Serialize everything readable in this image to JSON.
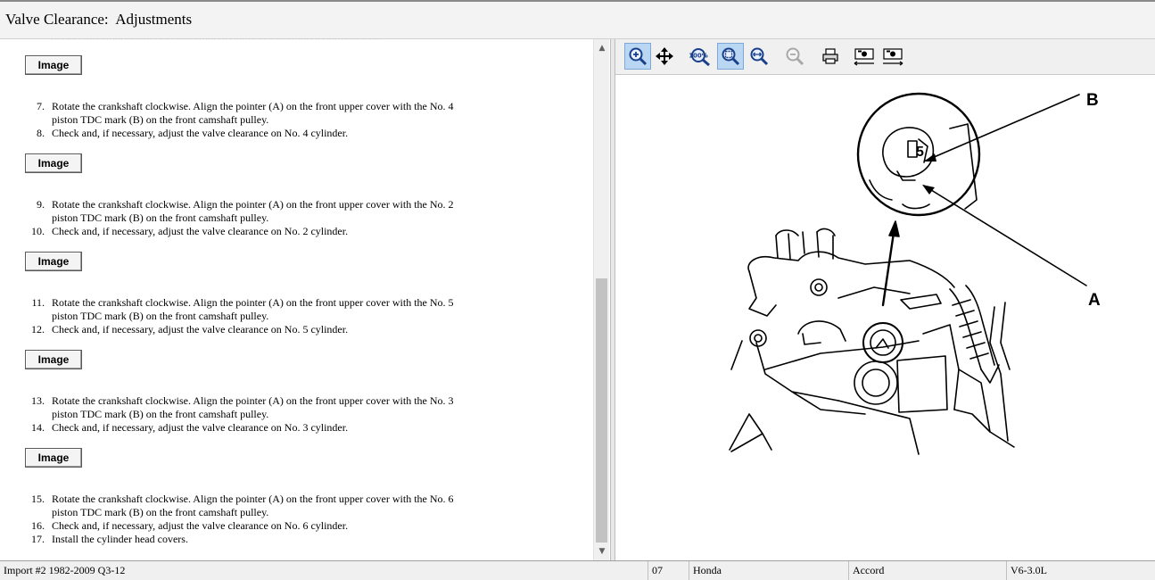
{
  "window": {
    "title": "Valve Clearance:  Adjustments"
  },
  "content": {
    "image_button_label": "Image",
    "steps": [
      {
        "num": "7.",
        "text": "Rotate the crankshaft clockwise. Align the pointer (A) on the front upper cover with the No. 4 piston TDC mark (B) on the front camshaft pulley."
      },
      {
        "num": "8.",
        "text": "Check and, if necessary, adjust the valve clearance on No. 4 cylinder."
      },
      {
        "num": "9.",
        "text": "Rotate the crankshaft clockwise. Align the pointer (A) on the front upper cover with the No. 2 piston TDC mark (B) on the front camshaft pulley."
      },
      {
        "num": "10.",
        "text": "Check and, if necessary, adjust the valve clearance on No. 2 cylinder."
      },
      {
        "num": "11.",
        "text": "Rotate the crankshaft clockwise. Align the pointer (A) on the front upper cover with the No. 5 piston TDC mark (B) on the front camshaft pulley."
      },
      {
        "num": "12.",
        "text": "Check and, if necessary, adjust the valve clearance on No. 5 cylinder."
      },
      {
        "num": "13.",
        "text": "Rotate the crankshaft clockwise. Align the pointer (A) on the front upper cover with the No. 3 piston TDC mark (B) on the front camshaft pulley."
      },
      {
        "num": "14.",
        "text": "Check and, if necessary, adjust the valve clearance on No. 3 cylinder."
      },
      {
        "num": "15.",
        "text": "Rotate the crankshaft clockwise. Align the pointer (A) on the front upper cover with the No. 6 piston TDC mark (B) on the front camshaft pulley."
      },
      {
        "num": "16.",
        "text": "Check and, if necessary, adjust the valve clearance on No. 6 cylinder."
      },
      {
        "num": "17.",
        "text": "Install the cylinder head covers."
      }
    ]
  },
  "viewer": {
    "toolbar": [
      {
        "name": "zoom-in-icon",
        "active": true
      },
      {
        "name": "pan-icon",
        "active": false
      },
      {
        "name": "actual-size-icon",
        "label": "100%",
        "active": false
      },
      {
        "name": "zoom-to-fit-icon",
        "active": true
      },
      {
        "name": "fit-width-icon",
        "active": false
      },
      {
        "name": "zoom-out-icon",
        "active": false,
        "disabled": true
      },
      {
        "name": "print-icon",
        "active": false
      },
      {
        "name": "previous-image-icon",
        "active": false
      },
      {
        "name": "next-image-icon",
        "active": false
      }
    ],
    "diagram": {
      "callouts": {
        "b": "B",
        "a": "A"
      },
      "mark_number": "5"
    }
  },
  "status": {
    "source": "Import #2 1982-2009 Q3-12",
    "year": "07",
    "make": "Honda",
    "model": "Accord",
    "engine": "V6-3.0L"
  },
  "colors": {
    "toolbar_active": "#b9d6f3",
    "icon": "#1a3f8a"
  }
}
